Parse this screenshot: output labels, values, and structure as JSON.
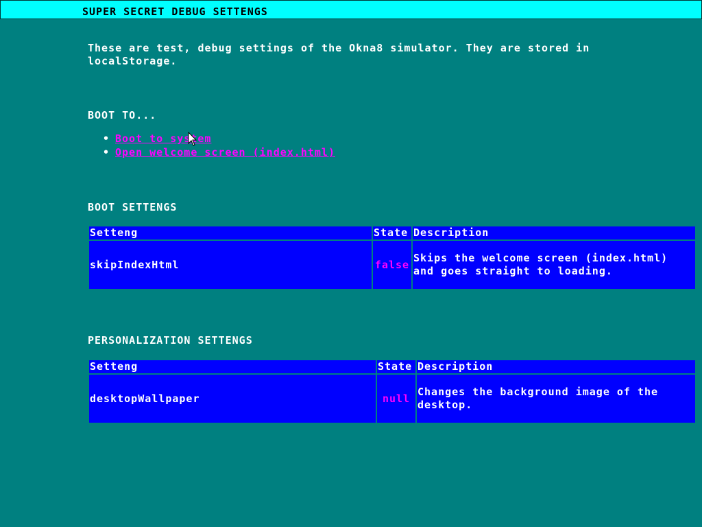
{
  "window": {
    "title": "SUPER SECRET DEBUG SETTENGS"
  },
  "intro": "These are test, debug settings of the Okna8 simulator. They are stored in localStorage.",
  "boot_to": {
    "heading": "BOOT TO...",
    "links": [
      {
        "label": "Boot to system"
      },
      {
        "label": "Open welcome screen (index.html)"
      }
    ]
  },
  "boot_settings": {
    "heading": "BOOT SETTENGS",
    "columns": [
      "Setteng",
      "State",
      "Description"
    ],
    "rows": [
      {
        "setting": "skipIndexHtml",
        "state": "false",
        "description": "Skips the welcome screen (index.html) and goes straight to loading."
      }
    ]
  },
  "personalization_settings": {
    "heading": "PERSONALIZATION SETTENGS",
    "columns": [
      "Setteng",
      "State",
      "Description"
    ],
    "rows": [
      {
        "setting": "desktopWallpaper",
        "state": "null",
        "description": "Changes the background image of the desktop."
      }
    ]
  },
  "colors": {
    "background": "#008080",
    "titlebar": "#00ffff",
    "table": "#0000ff",
    "link": "#ff00ff",
    "state_value": "#ff00ff"
  }
}
